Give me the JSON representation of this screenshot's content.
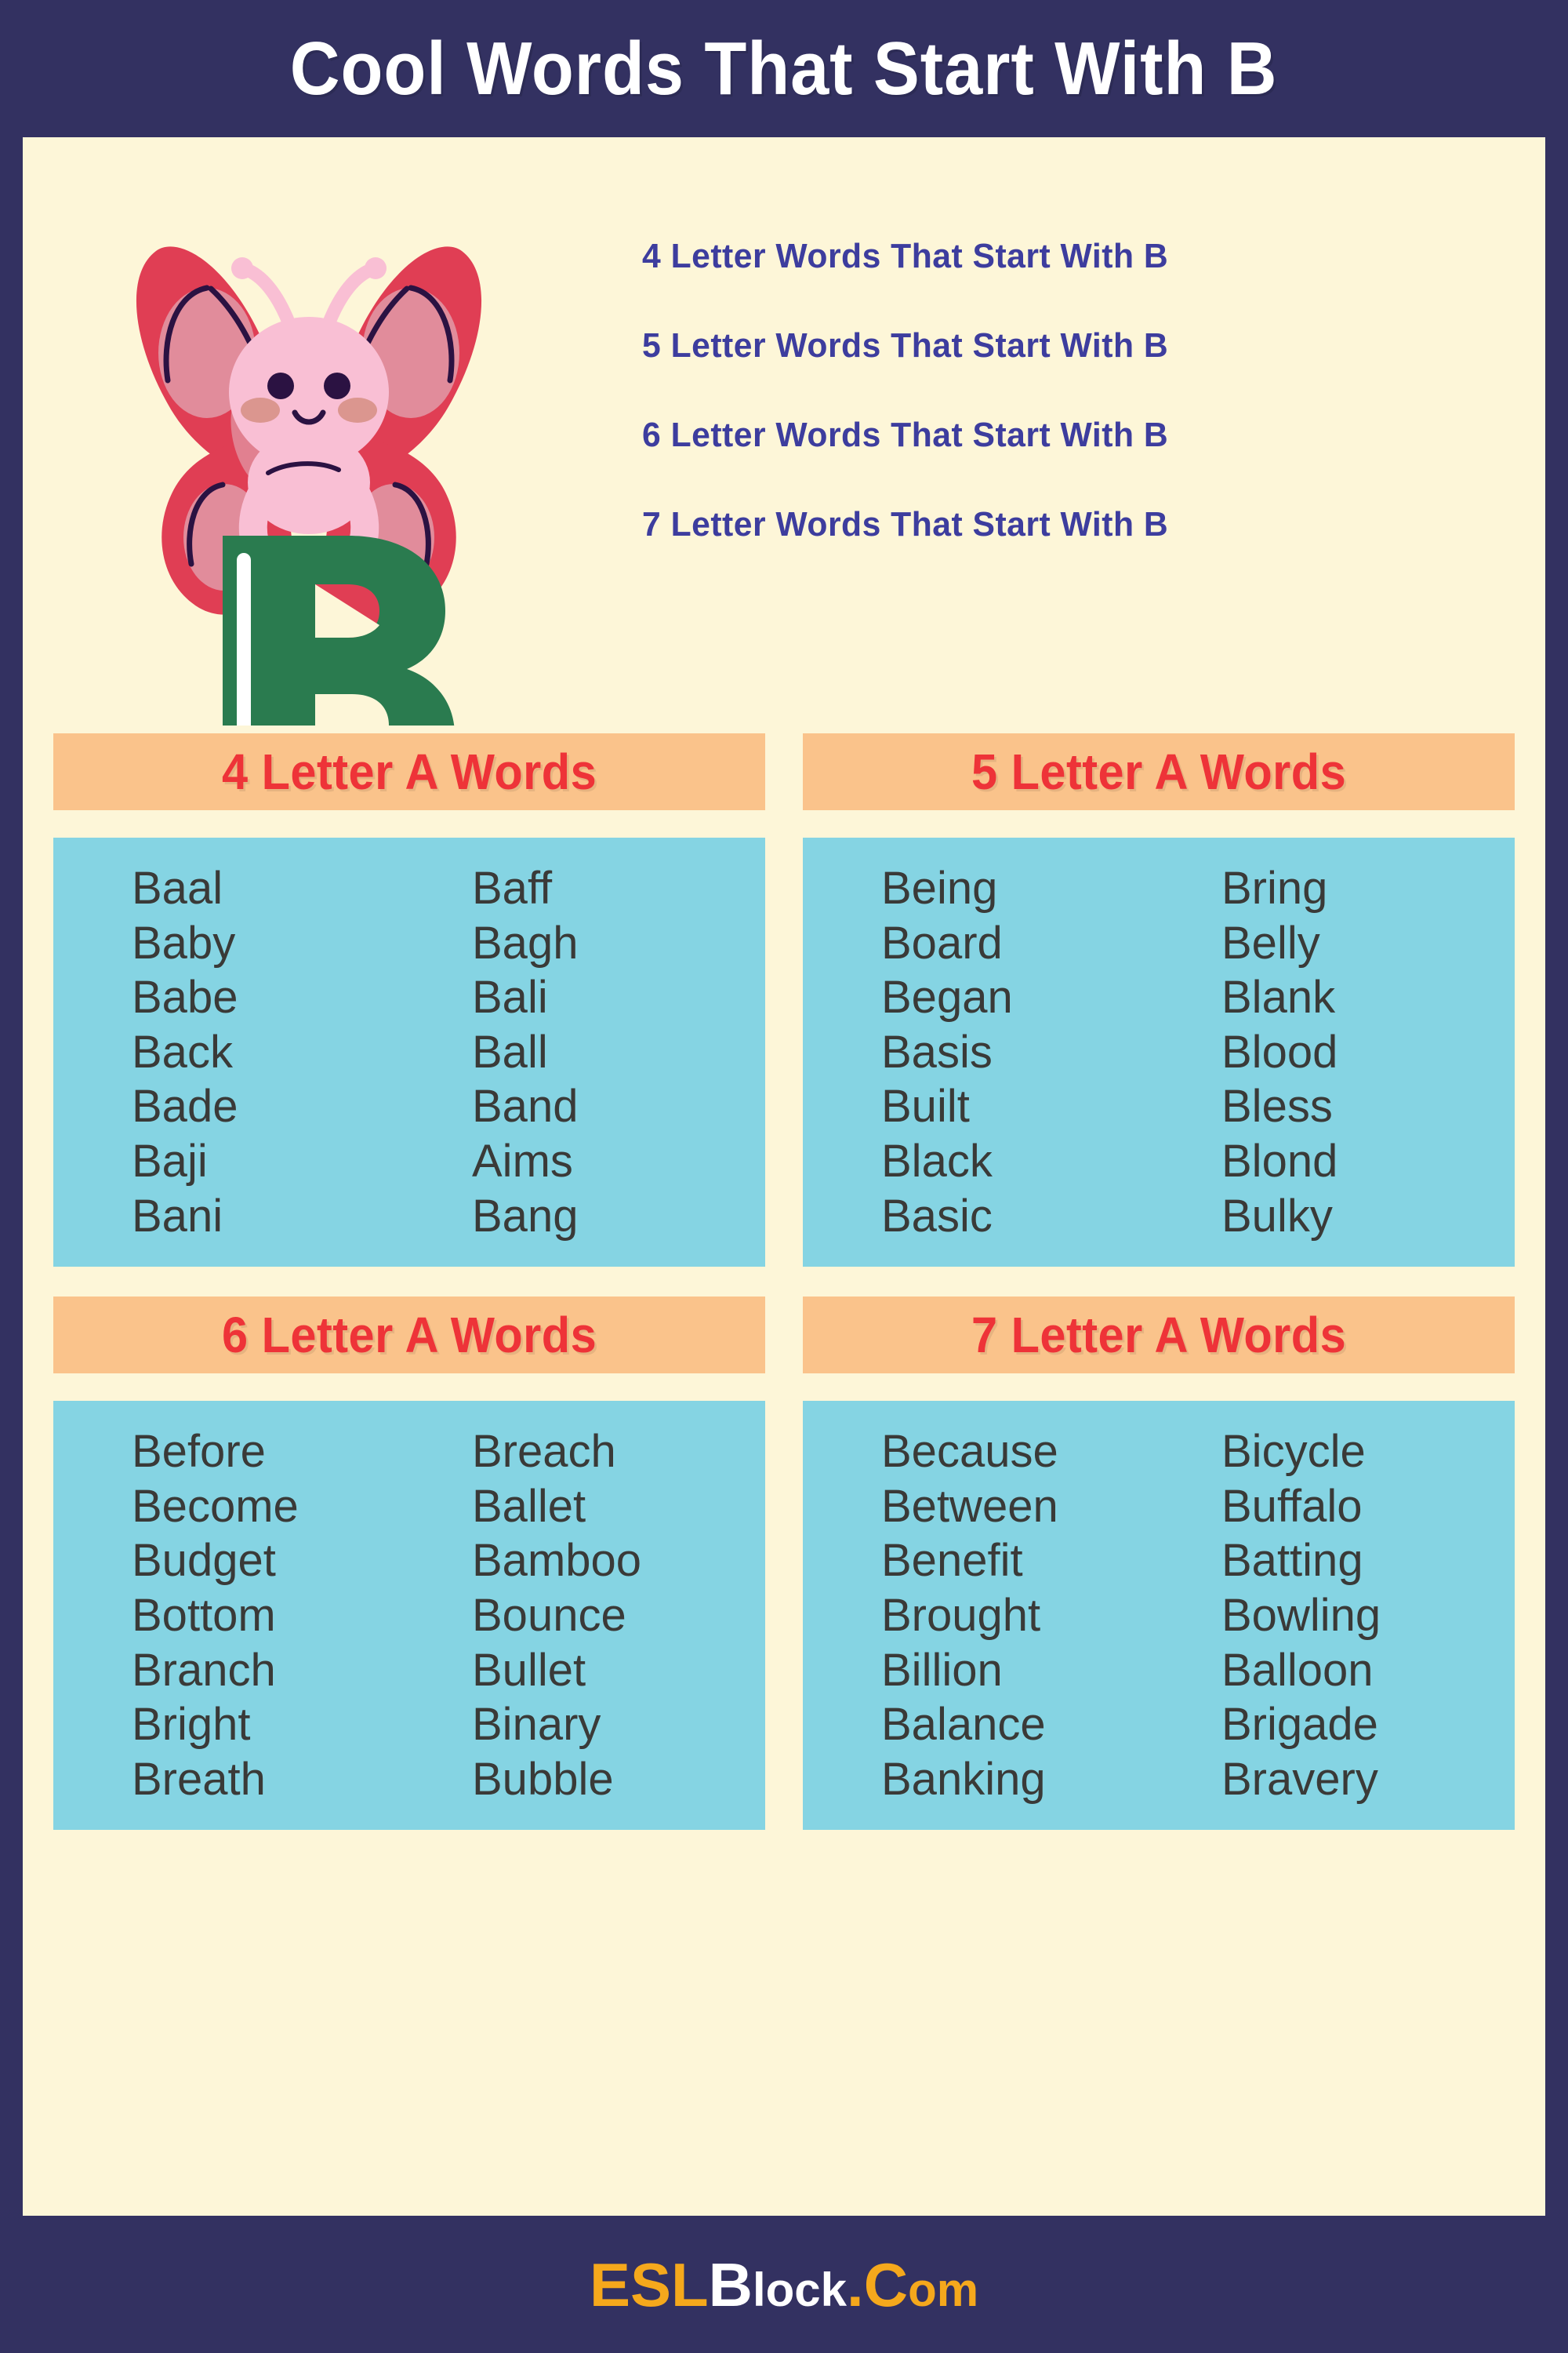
{
  "title": "Cool Words That Start With B",
  "hero": {
    "letter": "B",
    "mascot_icon": "butterfly-illustration",
    "toc": [
      "4 Letter Words That Start With B",
      "5 Letter Words That Start With B",
      "6 Letter Words That Start With B",
      "7 Letter Words That Start With B"
    ]
  },
  "sections": [
    {
      "header": "4 Letter A Words",
      "col_left": [
        "Baal",
        "Baby",
        "Babe",
        "Back",
        "Bade",
        "Baji",
        "Bani"
      ],
      "col_right": [
        "Baff",
        "Bagh",
        "Bali",
        "Ball",
        "Band",
        "Aims",
        "Bang"
      ]
    },
    {
      "header": "5 Letter A Words",
      "col_left": [
        "Being",
        "Board",
        "Began",
        "Basis",
        "Built",
        "Black",
        "Basic"
      ],
      "col_right": [
        "Bring",
        "Belly",
        "Blank",
        "Blood",
        "Bless",
        "Blond",
        "Bulky"
      ]
    },
    {
      "header": "6 Letter A Words",
      "col_left": [
        "Before",
        "Become",
        "Budget",
        "Bottom",
        "Branch",
        "Bright",
        "Breath"
      ],
      "col_right": [
        "Breach",
        "Ballet",
        "Bamboo",
        "Bounce",
        "Bullet",
        "Binary",
        "Bubble"
      ]
    },
    {
      "header": "7 Letter A Words",
      "col_left": [
        "Because",
        "Between",
        "Benefit",
        "Brought",
        "Billion",
        "Balance",
        "Banking"
      ],
      "col_right": [
        "Bicycle",
        "Buffalo",
        "Batting",
        "Bowling",
        "Balloon",
        "Brigade",
        "Bravery"
      ]
    }
  ],
  "footer": {
    "part_esl": "ESL",
    "part_b": "B",
    "part_lock": "lock",
    "part_dot": ".",
    "part_c": "C",
    "part_om": "om"
  },
  "colors": {
    "navy": "#333161",
    "cream": "#FDF6D8",
    "orange_header": "#FAC38B",
    "blue_body": "#85D4E3",
    "red_heading": "#EE3338",
    "toc_blue": "#3D3D9E",
    "word_text": "#3A3A38",
    "brand_orange": "#F5A81C",
    "letter_green": "#2A7B4F",
    "wing_red": "#E03E54",
    "wing_pink": "#E18C9B",
    "body_pink": "#F9BFD4"
  }
}
